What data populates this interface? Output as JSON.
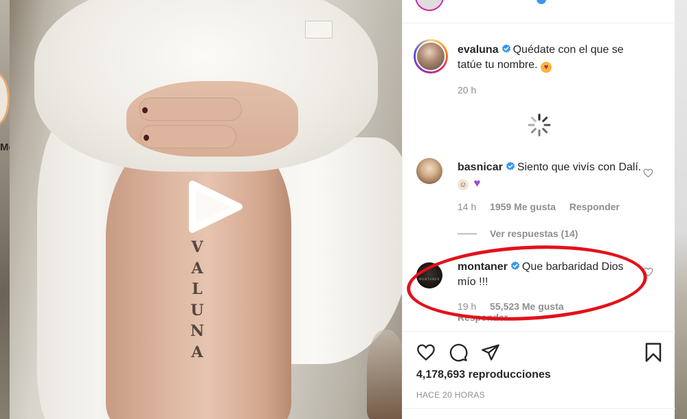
{
  "background": {
    "left_fragment_label": "Me"
  },
  "video": {
    "play_icon": "play-icon",
    "tattoo_letters": [
      "V",
      "A",
      "L",
      "U",
      "N",
      "A"
    ]
  },
  "post": {
    "caption": {
      "username": "evaluna",
      "verified_icon": "verified-badge-icon",
      "text": "Quédate con el que se tatúe tu nombre.",
      "emoji": "heart-eyes-cat-emoji",
      "time": "20 h"
    },
    "loading_icon": "loading-spinner-icon",
    "comments": [
      {
        "username": "basnicar",
        "verified_icon": "verified-badge-icon",
        "text": "Siento que vivís con Dalí.",
        "emojis": [
          "woman-emoji",
          "purple-heart-emoji"
        ],
        "time": "14 h",
        "likes": "1959 Me gusta",
        "reply_label": "Responder",
        "view_replies_label": "Ver respuestas (14)"
      },
      {
        "username": "montaner",
        "avatar_text": "MONTANER",
        "verified_icon": "verified-badge-icon",
        "text": "Que barbaridad Dios mío !!!",
        "time": "19 h",
        "likes": "55,523 Me gusta",
        "reply_label": "Responder"
      }
    ],
    "actions": {
      "like_icon": "heart-icon",
      "comment_icon": "comment-icon",
      "share_icon": "paper-plane-icon",
      "save_icon": "bookmark-icon"
    },
    "views": "4,178,693 reproducciones",
    "timestamp": "HACE 20 HORAS"
  },
  "colors": {
    "verified": "#3897f0",
    "highlight": "#e3111b",
    "text_primary": "#262626",
    "text_secondary": "#8e8e8e"
  }
}
